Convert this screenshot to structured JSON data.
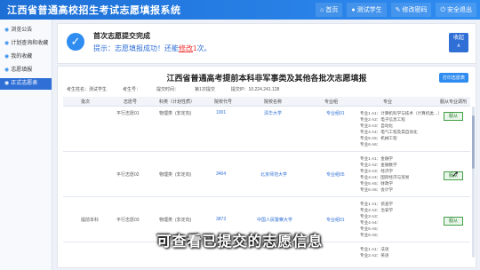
{
  "app": {
    "title": "江西省普通高校招生考试志愿填报系统"
  },
  "nav": [
    {
      "icon": "home-icon",
      "glyph": "⌂",
      "label": "首页"
    },
    {
      "icon": "user-icon",
      "glyph": "",
      "label": "测试学生"
    },
    {
      "icon": "key-icon",
      "glyph": "",
      "label": "修改密码"
    },
    {
      "icon": "logout-icon",
      "glyph": "",
      "label": "安全退出"
    }
  ],
  "sidebar": [
    {
      "label": "浏览公告",
      "active": false
    },
    {
      "label": "计划查询和收藏",
      "active": false
    },
    {
      "label": "我的收藏",
      "active": false
    },
    {
      "label": "志愿填报",
      "active": false
    },
    {
      "label": "正式志愿表",
      "active": true
    }
  ],
  "banner": {
    "title": "首次志愿提交完成",
    "msg_prefix": "提示：志愿填报成功！还能",
    "msg_link": "修改",
    "msg_count": "1",
    "msg_suffix": "次。"
  },
  "collapse": {
    "line1": "收起",
    "line2": "∧"
  },
  "sheet": {
    "title": "江西省普通高考提前本科非军事类及其他各批次志愿填报",
    "print_label": "打印志愿表",
    "info": {
      "candidate": "考生姓名：测试学生",
      "exam_no": "考生号：",
      "submit_time": "提交时间：",
      "submit_count": "第1次提交",
      "ip": "提交IP：10.224.241.128"
    },
    "headers": [
      "批次",
      "志愿号",
      "科类（计划性质）",
      "院校代号",
      "院校名称",
      "专业组",
      "专业",
      "服从专业调剂"
    ]
  },
  "rows": [
    {
      "batch": "",
      "volunteer": "平行志愿01",
      "subject": "物理类",
      "nature": "(非定向)",
      "code": "1001",
      "school": "清华大学",
      "group": "专业组01",
      "majors": [
        "专业1  A1：计算机科学与技术（计算机类…）",
        "专业2  A2：电子信息工程",
        "专业3  A3：自动化",
        "专业4  A4：电气工程及其自动化",
        "专业5  A5：机械工程",
        "专业6  A6："
      ],
      "adjust": "服从"
    },
    {
      "batch": "",
      "volunteer": "平行志愿02",
      "subject": "物理类",
      "nature": "(非定向)",
      "code": "3404",
      "school": "北京师范大学",
      "group": "专业组05",
      "majors": [
        "专业1  A1：金融学",
        "专业2  A2：金融数学",
        "专业3  A3：经济学",
        "专业4  A4：国际经济与贸易",
        "专业5  A5：财政学",
        "专业6  A6：会计学"
      ],
      "adjust": "服从"
    },
    {
      "batch": "提前本科",
      "volunteer": "平行志愿03",
      "subject": "物理类",
      "nature": "(非定向)",
      "code": "3873",
      "school": "中国人民警察大学",
      "group": "专业组01",
      "majors": [
        "专业1  A1：侦查学",
        "专业2  A2：治安学",
        "专业3  A3：",
        "专业4  A4：",
        "专业5  A5：",
        "专业6  A6："
      ],
      "adjust": "服从"
    },
    {
      "batch": "",
      "volunteer": "平行志愿04",
      "subject": "",
      "nature": "",
      "code": "",
      "school": "",
      "group": "",
      "majors": [
        "专业1  A1：法语",
        "专业2  A2：英语"
      ],
      "adjust": ""
    }
  ],
  "caption": "可查看已提交的志愿信息"
}
